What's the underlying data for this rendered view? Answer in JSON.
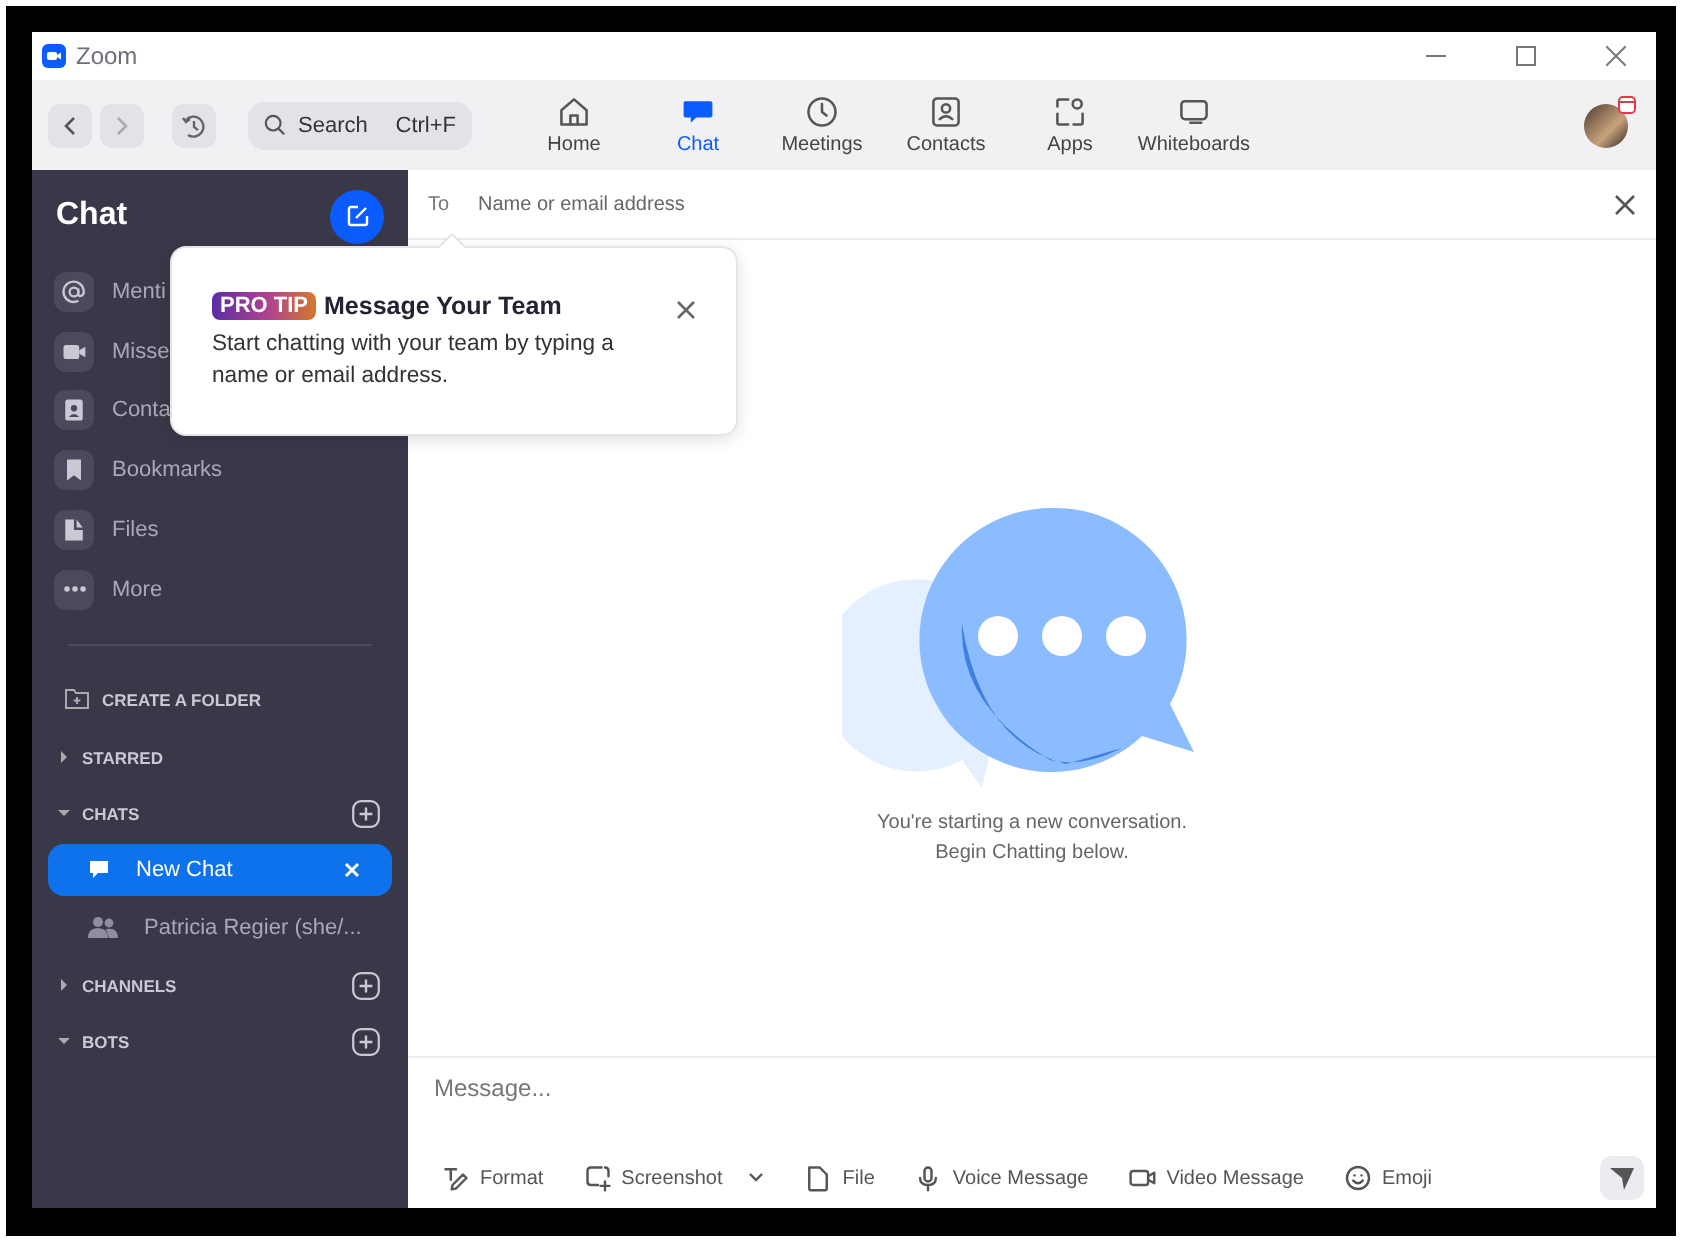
{
  "window": {
    "title": "Zoom"
  },
  "toolbar": {
    "search": {
      "placeholder": "Search",
      "shortcut": "Ctrl+F"
    },
    "tabs": [
      {
        "label": "Home",
        "selected": false
      },
      {
        "label": "Chat",
        "selected": true
      },
      {
        "label": "Meetings",
        "selected": false
      },
      {
        "label": "Contacts",
        "selected": false
      },
      {
        "label": "Apps",
        "selected": false
      },
      {
        "label": "Whiteboards",
        "selected": false
      }
    ]
  },
  "sidebar": {
    "title": "Chat",
    "items": [
      {
        "label": "Menti"
      },
      {
        "label": "Misse"
      },
      {
        "label": "Conta"
      },
      {
        "label": "Bookmarks"
      },
      {
        "label": "Files"
      },
      {
        "label": "More"
      }
    ],
    "create_folder": "CREATE A FOLDER",
    "sections": [
      {
        "label": "STARRED",
        "expanded": false,
        "addable": false
      },
      {
        "label": "CHATS",
        "expanded": true,
        "addable": true,
        "items": [
          {
            "label": "New Chat",
            "selected": true
          },
          {
            "label": "Patricia Regier (she/...",
            "selected": false
          }
        ]
      },
      {
        "label": "CHANNELS",
        "expanded": false,
        "addable": true
      },
      {
        "label": "BOTS",
        "expanded": true,
        "addable": true
      }
    ]
  },
  "to_field": {
    "label": "To",
    "placeholder": "Name or email address"
  },
  "tip": {
    "badge": "PRO TIP",
    "title": "Message Your Team",
    "text": "Start chatting with your team by typing a name or email address."
  },
  "empty_state": {
    "lines": [
      "You're starting a new conversation.",
      "Begin Chatting below."
    ]
  },
  "composer": {
    "placeholder": "Message...",
    "tools": [
      {
        "label": "Format",
        "menu": false
      },
      {
        "label": "Screenshot",
        "menu": true
      },
      {
        "label": "File",
        "menu": false
      },
      {
        "label": "Voice Message",
        "menu": false
      },
      {
        "label": "Video Message",
        "menu": false
      },
      {
        "label": "Emoji",
        "menu": false
      }
    ]
  }
}
